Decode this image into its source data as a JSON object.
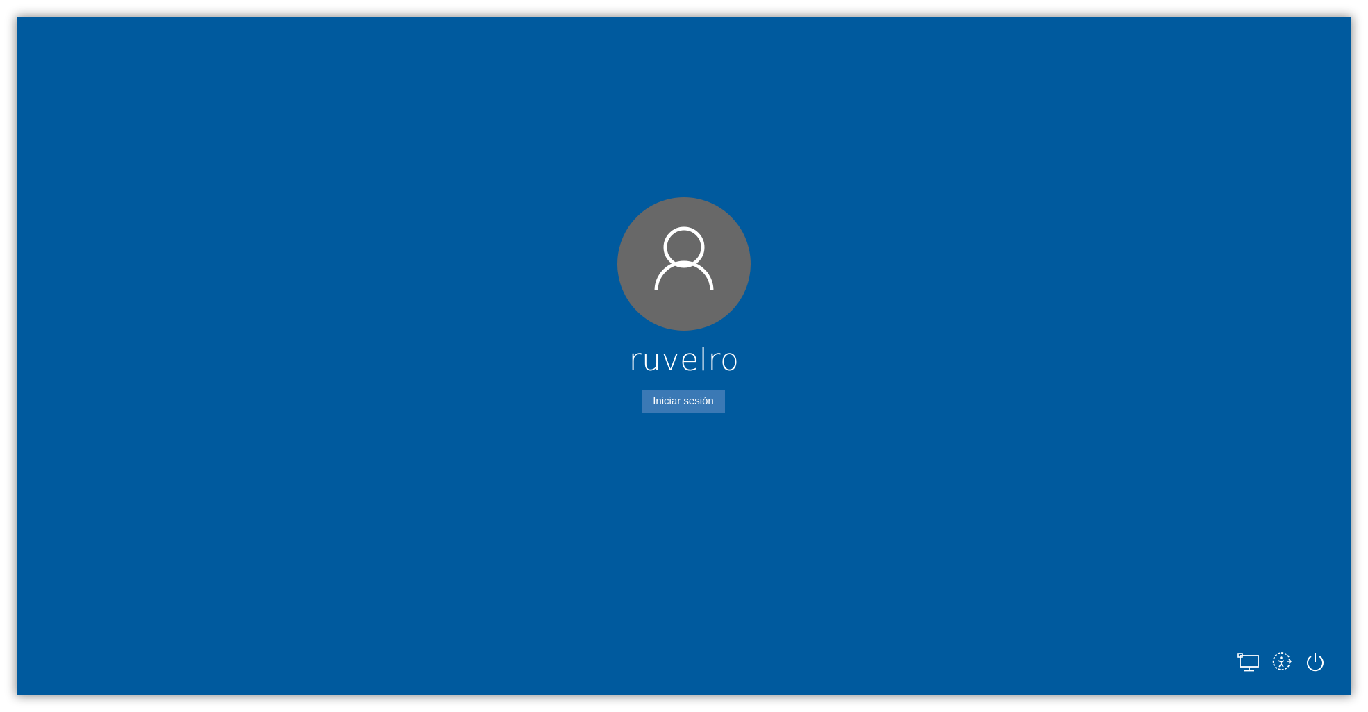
{
  "account": {
    "username": "ruvelro",
    "avatar_icon": "user-silhouette-icon"
  },
  "signin": {
    "button_label": "Iniciar sesión"
  },
  "tray": {
    "network_icon": "network-icon",
    "ease_of_access_icon": "ease-of-access-icon",
    "power_icon": "power-icon"
  },
  "colors": {
    "background": "#005a9e",
    "avatar_circle": "#686868",
    "button": "#3b79b5",
    "text": "#ffffff"
  }
}
